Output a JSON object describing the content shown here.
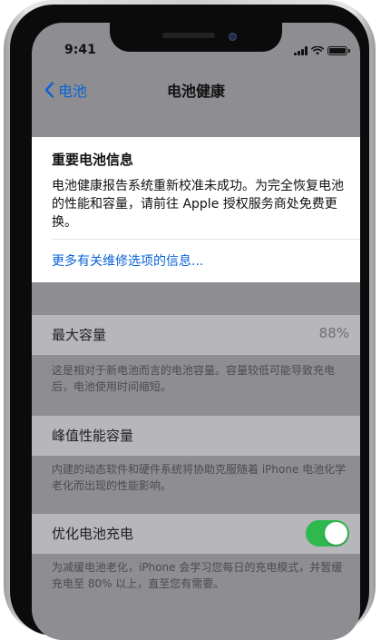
{
  "status_bar": {
    "time": "9:41"
  },
  "nav": {
    "back_label": "电池",
    "title": "电池健康"
  },
  "notice": {
    "title": "重要电池信息",
    "body": "电池健康报告系统重新校准未成功。为完全恢复电池的性能和容量，请前往 Apple 授权服务商处免费更换。",
    "link": "更多有关维修选项的信息..."
  },
  "max_capacity": {
    "label": "最大容量",
    "value": "88%",
    "footnote": "这是相对于新电池而言的电池容量。容量较低可能导致充电后，电池使用时间缩短。"
  },
  "peak_performance": {
    "label": "峰值性能容量",
    "footnote": "内建的动态软件和硬件系统将协助克服随着 iPhone 电池化学老化而出现的性能影响。"
  },
  "optimized_charging": {
    "label": "优化电池充电",
    "enabled": true,
    "footnote": "为减缓电池老化，iPhone 会学习您每日的充电模式，并暂缓充电至 80% 以上，直至您有需要。"
  },
  "colors": {
    "accent": "#0a63d8",
    "toggle_on": "#2eb84e"
  }
}
